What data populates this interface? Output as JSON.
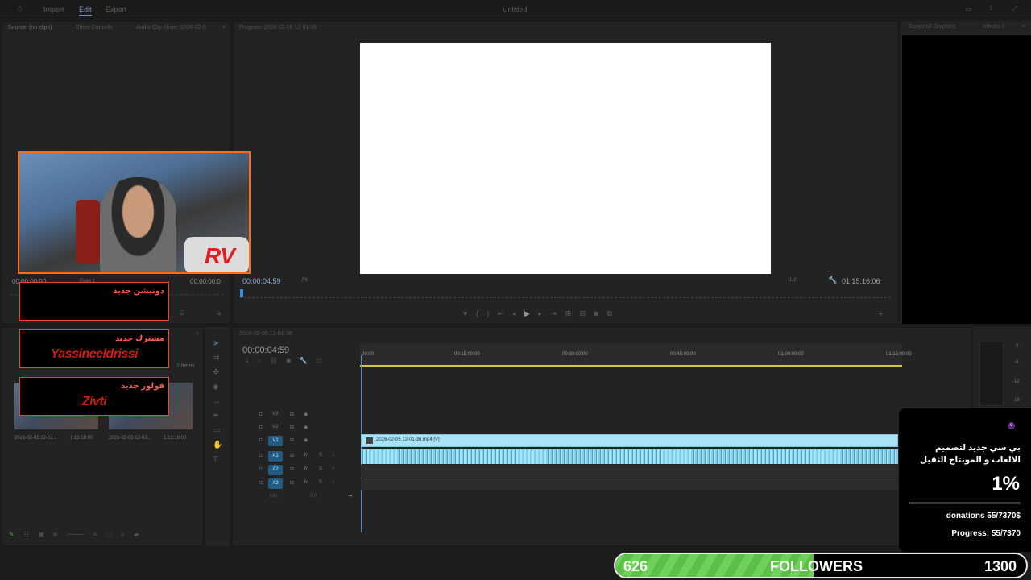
{
  "topbar": {
    "import": "Import",
    "edit": "Edit",
    "export": "Export",
    "title": "Untitled"
  },
  "source_panel": {
    "tabs": [
      "Source: (no clips)",
      "Effect Controls",
      "Audio Clip Mixer: 2026-02-0"
    ],
    "timecode_left": "00:00:00:00",
    "page": "Page 1",
    "timecode_right": "00:00:00:0"
  },
  "program_panel": {
    "tab": "Program: 2026-02-05 12-01-36",
    "timecode_left": "00:00:04:59",
    "fit": "Fit",
    "fraction": "1/2",
    "duration": "01:15:16:06"
  },
  "right_panel": {
    "tabs": [
      "Essential Graphics",
      "Affects II"
    ]
  },
  "project_panel": {
    "items_count": "2 items",
    "thumbs": [
      {
        "name": "2026-02-05 12-01...",
        "duration": "1:15:16:00"
      },
      {
        "name": "2026-02-05 12-01...",
        "duration": "1:15:16:00"
      }
    ]
  },
  "timeline": {
    "tab": "2026-02-05 12-01-36",
    "timecode": "00:00:04:59",
    "ruler": [
      "00:00",
      "00:15:00:00",
      "00:30:00:00",
      "00:45:00:00",
      "01:00:00:00",
      "01:15:00:00"
    ],
    "tracks_video": [
      "V3",
      "V2",
      "V1"
    ],
    "tracks_audio": [
      "A1",
      "A2",
      "A3"
    ],
    "mix_label": "Mix",
    "mix_value": "0.0",
    "clip_label": "2026-02-05 12-01-36.mp4 [V]"
  },
  "meter": {
    "ticks": [
      "0",
      "-6",
      "-12",
      "-18"
    ]
  },
  "webcam": {
    "logo": "RV"
  },
  "overlays": {
    "donation_title": "دونيشن جديد",
    "subscriber_title": "مشترك جديد",
    "subscriber_name": "Yassineeldrissi",
    "follower_title": "فولور جديد",
    "follower_name": "Zivti"
  },
  "donation_goal": {
    "title": "بي سي جديد لتصميم الالعاب و المونتاج الثقيل",
    "percent": "1%",
    "progress_value": 0.01,
    "donations": "donations 55/7370$",
    "progress": "Progress: 55/7370"
  },
  "followers_bar": {
    "current": "626",
    "label": "FOLLOWERS",
    "goal": "1300",
    "progress_value": 0.4815
  },
  "colors": {
    "accent": "#1f5c86",
    "clip": "#a9e3f5",
    "alert": "#ff3b2f",
    "followers": "#6fd15a"
  }
}
